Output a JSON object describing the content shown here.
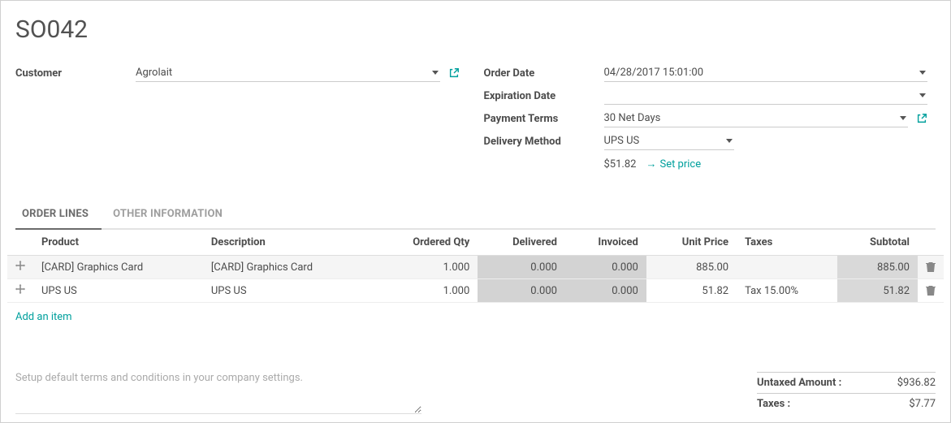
{
  "order": {
    "name": "SO042",
    "customer_label": "Customer",
    "customer": "Agrolait",
    "order_date_label": "Order Date",
    "order_date": "04/28/2017 15:01:00",
    "expiration_date_label": "Expiration Date",
    "expiration_date": "",
    "payment_terms_label": "Payment Terms",
    "payment_terms": "30 Net Days",
    "delivery_method_label": "Delivery Method",
    "delivery_method": "UPS US",
    "delivery_price": "$51.82",
    "set_price_label": "Set price"
  },
  "tabs": {
    "order_lines": "ORDER LINES",
    "other_info": "OTHER INFORMATION"
  },
  "columns": {
    "product": "Product",
    "description": "Description",
    "ordered_qty": "Ordered Qty",
    "delivered": "Delivered",
    "invoiced": "Invoiced",
    "unit_price": "Unit Price",
    "taxes": "Taxes",
    "subtotal": "Subtotal"
  },
  "lines": [
    {
      "product": "[CARD] Graphics Card",
      "description": "[CARD] Graphics Card",
      "ordered_qty": "1.000",
      "delivered": "0.000",
      "invoiced": "0.000",
      "unit_price": "885.00",
      "taxes": "",
      "subtotal": "885.00"
    },
    {
      "product": "UPS US",
      "description": "UPS US",
      "ordered_qty": "1.000",
      "delivered": "0.000",
      "invoiced": "0.000",
      "unit_price": "51.82",
      "taxes": "Tax 15.00%",
      "subtotal": "51.82"
    }
  ],
  "add_item": "Add an item",
  "terms_placeholder": "Setup default terms and conditions in your company settings.",
  "totals": {
    "untaxed_label": "Untaxed Amount :",
    "untaxed": "$936.82",
    "taxes_label": "Taxes :",
    "taxes": "$7.77"
  }
}
